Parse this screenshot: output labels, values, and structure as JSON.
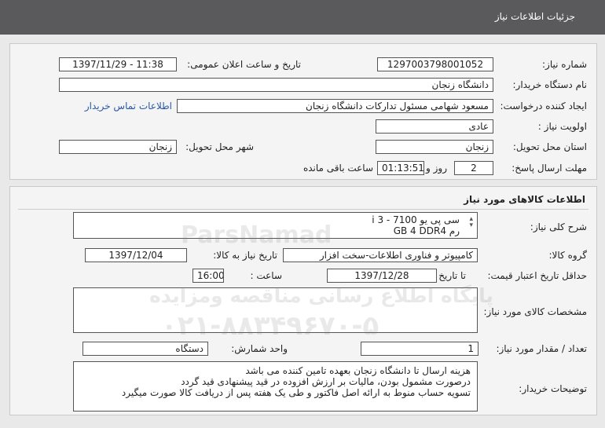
{
  "header": {
    "title": "جزئیات اطلاعات نیاز"
  },
  "general": {
    "need_number_label": "شماره نیاز:",
    "need_number": "1297003798001052",
    "announce_label": "تاریخ و ساعت اعلان عمومی:",
    "announce_value": "1397/11/29 - 11:38",
    "buyer_label": "نام دستگاه خریدار:",
    "buyer_value": "دانشگاه زنجان",
    "creator_label": "ایجاد کننده درخواست:",
    "creator_value": "مسعود شهامی مسئول تدارکات دانشگاه زنجان",
    "contact_link": "اطلاعات تماس خریدار",
    "priority_label": "اولویت نیاز :",
    "priority_value": "عادی",
    "province_label": "استان محل تحویل:",
    "province_value": "زنجان",
    "city_label": "شهر محل تحویل:",
    "city_value": "زنجان",
    "deadline_label": "مهلت ارسال پاسخ:",
    "days_value": "2",
    "days_unit": "روز و",
    "time_value": "01:13:51",
    "time_unit": "ساعت باقی مانده"
  },
  "goods": {
    "section_title": "اطلاعات کالاهای مورد نیاز",
    "summary_label": "شرح کلی نیاز:",
    "summary_line1": "سی پی یو 7100 - i 3",
    "summary_line2": "رم GB 4 DDR4",
    "group_label": "گروه کالا:",
    "group_value": "کامپیوتر و فناوری اطلاعات-سخت افزار",
    "need_date_label": "تاریخ نیاز به کالا:",
    "need_date_value": "1397/12/04",
    "price_valid_label": "حداقل تاریخ اعتبار قیمت:",
    "to_date_label": "تا تاریخ :",
    "to_date_value": "1397/12/28",
    "hour_label": "ساعت :",
    "hour_value": "16:00",
    "spec_label": "مشخصات کالای مورد نیاز:",
    "qty_label": "تعداد / مقدار مورد نیاز:",
    "qty_value": "1",
    "unit_label": "واحد شمارش:",
    "unit_value": "دستگاه",
    "notes_label": "توضیحات خریدار:",
    "notes_lines": [
      "هزینه ارسال تا دانشگاه زنجان بعهده تامین کننده می باشد",
      "درصورت مشمول بودن، مالیات بر ارزش افزوده در قید پیشنهادی قید گردد",
      "تسویه حساب منوط به ارائه اصل فاکتور و طی یک هفته پس از دریافت کالا صورت میگیرد"
    ]
  },
  "watermark": {
    "brand": "ParsNamad",
    "line1": "پایگاه اطلاع رسانی مناقصه ومزایده",
    "phone": "۰۲۱-۸۸۳۴۹۶۷۰-۵"
  }
}
